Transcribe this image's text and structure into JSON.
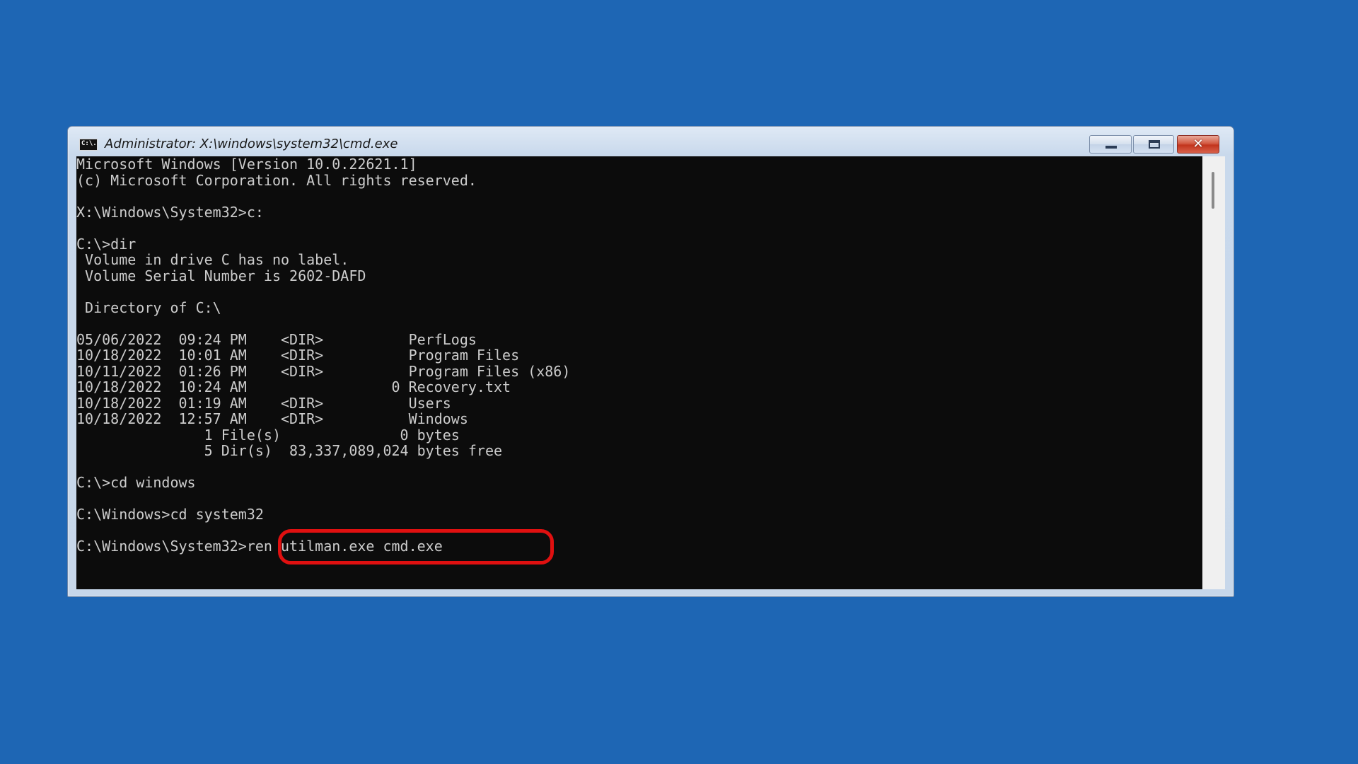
{
  "window": {
    "title": "Administrator: X:\\windows\\system32\\cmd.exe",
    "icon": "cmd-icon",
    "icon_text": "C:\\."
  },
  "controls": {
    "minimize": "minimize-icon",
    "maximize": "maximize-icon",
    "close_label": "✕"
  },
  "console": {
    "lines": [
      "Microsoft Windows [Version 10.0.22621.1]",
      "(c) Microsoft Corporation. All rights reserved.",
      "",
      "X:\\Windows\\System32>c:",
      "",
      "C:\\>dir",
      " Volume in drive C has no label.",
      " Volume Serial Number is 2602-DAFD",
      "",
      " Directory of C:\\",
      "",
      "05/06/2022  09:24 PM    <DIR>          PerfLogs",
      "10/18/2022  10:01 AM    <DIR>          Program Files",
      "10/11/2022  01:26 PM    <DIR>          Program Files (x86)",
      "10/18/2022  10:24 AM                 0 Recovery.txt",
      "10/18/2022  01:19 AM    <DIR>          Users",
      "10/18/2022  12:57 AM    <DIR>          Windows",
      "               1 File(s)              0 bytes",
      "               5 Dir(s)  83,337,089,024 bytes free",
      "",
      "C:\\>cd windows",
      "",
      "C:\\Windows>cd system32",
      "",
      "C:\\Windows\\System32>ren utilman.exe cmd.exe"
    ]
  },
  "annotation": {
    "highlight_color": "#e01010"
  }
}
